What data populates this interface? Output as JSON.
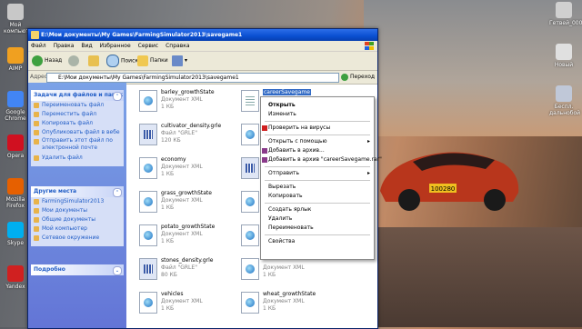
{
  "desktop": {
    "left_icons": [
      {
        "label": "Мой компьютер",
        "color": "#c8c8c8"
      },
      {
        "label": "AIMP",
        "color": "#f0a020"
      },
      {
        "label": "Google Chrome",
        "color": "#4285f4"
      },
      {
        "label": "Opera",
        "color": "#d01020"
      },
      {
        "label": "Mozilla Firefox",
        "color": "#e66000"
      },
      {
        "label": "Skype",
        "color": "#00aff0"
      },
      {
        "label": "Yandex",
        "color": "#d02020"
      }
    ],
    "right_icons": [
      {
        "label": "Гетвей_0001",
        "color": "#d0d0d0"
      },
      {
        "label": "Новый",
        "color": "#e0e0e0"
      },
      {
        "label": "Беспл. дальнобой",
        "color": "#c0c8d8"
      }
    ]
  },
  "window": {
    "title": "E:\\Мои документы\\My Games\\FarmingSimulator2013\\savegame1",
    "menu": [
      "Файл",
      "Правка",
      "Вид",
      "Избранное",
      "Сервис",
      "Справка"
    ],
    "toolbar": {
      "back": "Назад",
      "search": "Поиск",
      "folders": "Папки"
    },
    "address": {
      "label": "Адрес:",
      "path": "E:\\Мои документы\\My Games\\FarmingSimulator2013\\savegame1",
      "go": "Переход"
    }
  },
  "tasks": {
    "file_tasks": {
      "title": "Задачи для файлов и папок",
      "items": [
        "Переименовать файл",
        "Переместить файл",
        "Копировать файл",
        "Опубликовать файл в вебе",
        "Отправить этот файл по электронной почте",
        "Удалить файл"
      ]
    },
    "other_places": {
      "title": "Другие места",
      "items": [
        "FarmingSimulator2013",
        "Мои документы",
        "Общие документы",
        "Мой компьютер",
        "Сетевое окружение"
      ]
    },
    "details": {
      "title": "Подробно"
    }
  },
  "files": [
    {
      "name": "barley_growthState",
      "type": "Документ XML",
      "size": "1 КБ",
      "icon": "xml"
    },
    {
      "name": "careerSavegame",
      "type": "",
      "size": "",
      "icon": "txt",
      "selected": true
    },
    {
      "name": "cultivator_density.grle",
      "type": "Файл \"GRLE\"",
      "size": "120 КБ",
      "icon": "grle"
    },
    {
      "name": "",
      "type": "",
      "size": "",
      "icon": "xml"
    },
    {
      "name": "economy",
      "type": "Документ XML",
      "size": "1 КБ",
      "icon": "xml"
    },
    {
      "name": "",
      "type": "",
      "size": "",
      "icon": "grle"
    },
    {
      "name": "grass_growthState",
      "type": "Документ XML",
      "size": "1 КБ",
      "icon": "xml"
    },
    {
      "name": "",
      "type": "",
      "size": "",
      "icon": "xml"
    },
    {
      "name": "potato_growthState",
      "type": "Документ XML",
      "size": "1 КБ",
      "icon": "xml"
    },
    {
      "name": "",
      "type": "",
      "size": "",
      "icon": "xml"
    },
    {
      "name": "stones_density.grle",
      "type": "Файл \"GRLE\"",
      "size": "80 КБ",
      "icon": "grle"
    },
    {
      "name": "",
      "type": "Документ XML",
      "size": "1 КБ",
      "icon": "xml"
    },
    {
      "name": "vehicles",
      "type": "Документ XML",
      "size": "1 КБ",
      "icon": "xml"
    },
    {
      "name": "wheat_growthState",
      "type": "Документ XML",
      "size": "1 КБ",
      "icon": "xml"
    }
  ],
  "context_menu": {
    "items": [
      {
        "label": "Открыть",
        "bold": true
      },
      {
        "label": "Изменить"
      },
      {
        "sep": true
      },
      {
        "label": "Проверить на вирусы",
        "icon": "#d02020"
      },
      {
        "sep": true
      },
      {
        "label": "Открыть с помощью",
        "submenu": true
      },
      {
        "label": "Добавить в архив...",
        "icon": "#8a3a8a"
      },
      {
        "label": "Добавить в архив \"careerSavegame.rar\"",
        "icon": "#8a3a8a"
      },
      {
        "sep": true
      },
      {
        "label": "Отправить",
        "submenu": true
      },
      {
        "sep": true
      },
      {
        "label": "Вырезать"
      },
      {
        "label": "Копировать"
      },
      {
        "sep": true
      },
      {
        "label": "Создать ярлык"
      },
      {
        "label": "Удалить"
      },
      {
        "label": "Переименовать"
      },
      {
        "sep": true
      },
      {
        "label": "Свойства"
      }
    ]
  },
  "car_plate": "100280"
}
